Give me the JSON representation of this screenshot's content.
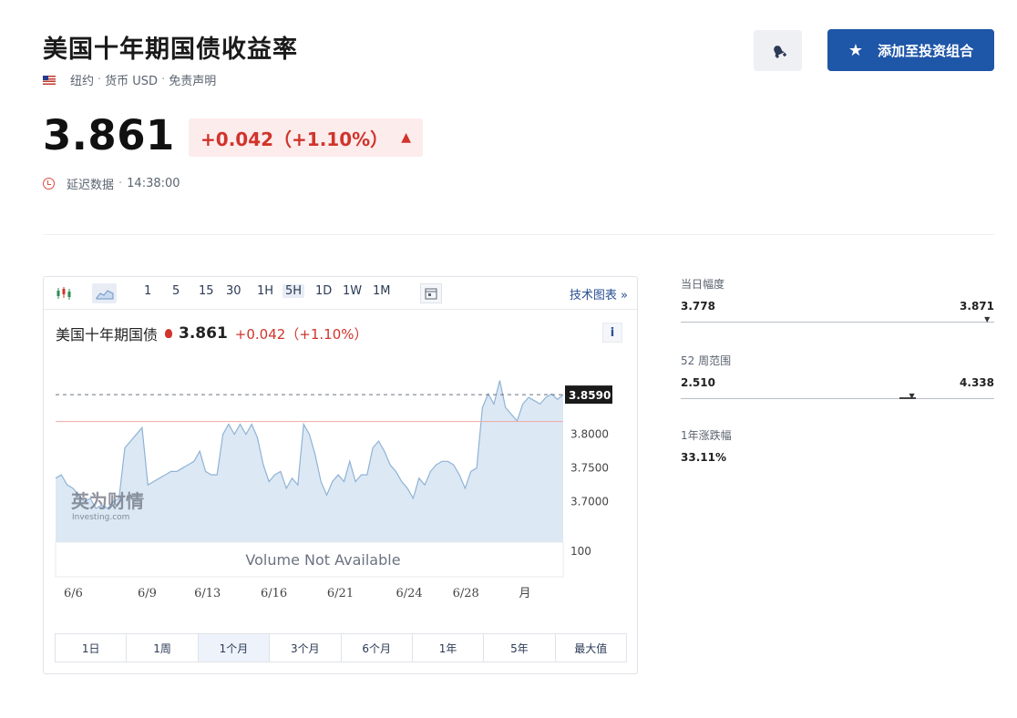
{
  "header": {
    "title": "美国十年期国债收益率",
    "location": "纽约",
    "currency": "货币 USD",
    "disclaimer": "免责声明",
    "add_button_label": "添加至投资组合"
  },
  "quote": {
    "price": "3.861",
    "change": "+0.042（+1.10%）",
    "delay_label": "延迟数据",
    "time": "14:38:00"
  },
  "toolbar": {
    "intervals": [
      "1",
      "5",
      "15",
      "30",
      "1H",
      "5H",
      "1D",
      "1W",
      "1M"
    ],
    "selected_interval": "5H",
    "tech_chart_link": "技术图表 »"
  },
  "chart_header": {
    "name": "美国十年期国债",
    "value": "3.861",
    "change": "+0.042（+1.10%）",
    "info_label": "i"
  },
  "chart_data": {
    "type": "area",
    "x_labels": [
      "6/6",
      "6/9",
      "6/13",
      "6/16",
      "6/21",
      "6/24",
      "6/28",
      "月"
    ],
    "y_ticks": [
      "3.8000",
      "3.7500",
      "3.7000"
    ],
    "ylim": [
      3.64,
      3.92
    ],
    "last_value_label": "3.8590",
    "last_value": 3.859,
    "reference_line": 3.819,
    "volume_label": "Volume Not Available",
    "volume_tick": "100",
    "watermark": "英为财情",
    "watermark_sub": "Investing.com",
    "values": [
      3.735,
      3.74,
      3.725,
      3.72,
      3.71,
      3.7,
      3.705,
      3.69,
      3.695,
      3.69,
      3.7,
      3.705,
      3.78,
      3.79,
      3.8,
      3.81,
      3.725,
      3.73,
      3.735,
      3.74,
      3.745,
      3.745,
      3.75,
      3.755,
      3.76,
      3.775,
      3.745,
      3.74,
      3.74,
      3.8,
      3.815,
      3.8,
      3.815,
      3.8,
      3.815,
      3.795,
      3.755,
      3.73,
      3.74,
      3.745,
      3.72,
      3.735,
      3.725,
      3.815,
      3.8,
      3.77,
      3.73,
      3.71,
      3.73,
      3.74,
      3.73,
      3.76,
      3.73,
      3.74,
      3.74,
      3.78,
      3.79,
      3.775,
      3.755,
      3.745,
      3.73,
      3.72,
      3.705,
      3.735,
      3.725,
      3.745,
      3.755,
      3.76,
      3.76,
      3.755,
      3.74,
      3.72,
      3.745,
      3.75,
      3.84,
      3.86,
      3.845,
      3.88,
      3.84,
      3.83,
      3.82,
      3.845,
      3.855,
      3.85,
      3.845,
      3.855,
      3.86,
      3.852,
      3.859
    ]
  },
  "range_tabs": [
    "1日",
    "1周",
    "1个月",
    "3个月",
    "6个月",
    "1年",
    "5年",
    "最大值"
  ],
  "selected_range": "1个月",
  "stats": {
    "day_range": {
      "label": "当日幅度",
      "low": "3.778",
      "high": "3.871",
      "marker": 0.98
    },
    "week52_range": {
      "label": "52 周范围",
      "low": "2.510",
      "high": "4.338",
      "marker": 0.74
    },
    "year_change": {
      "label": "1年涨跌幅",
      "value": "33.11%"
    }
  },
  "colors": {
    "accent_blue": "#1e56a8",
    "up_red": "#d0342c",
    "area_fill": "#dce8f4",
    "area_line": "#8fb3d6"
  }
}
